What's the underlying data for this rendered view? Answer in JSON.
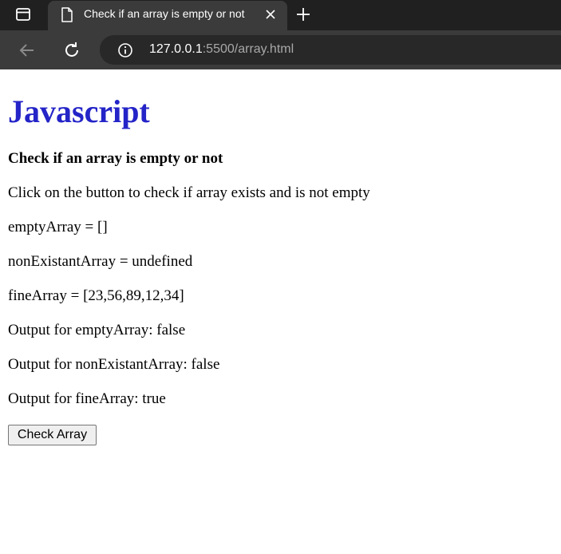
{
  "browser": {
    "tab": {
      "title": "Check if an array is empty or not"
    },
    "address": {
      "host": "127.0.0.1",
      "rest": ":5500/array.html"
    }
  },
  "page": {
    "heading": "Javascript",
    "subheading": "Check if an array is empty or not",
    "instruction": "Click on the button to check if array exists and is not empty",
    "empty_array": "emptyArray = []",
    "non_existant_array": "nonExistantArray = undefined",
    "fine_array": "fineArray = [23,56,89,12,34]",
    "output_empty": "Output for emptyArray: false",
    "output_non_existant": "Output for nonExistantArray: false",
    "output_fine": "Output for fineArray: true",
    "button_label": "Check Array"
  },
  "colors": {
    "heading": "#2424c8",
    "tabbar_bg": "#202020",
    "toolbar_bg": "#3b3b3b",
    "url_box_bg": "#282828"
  },
  "icons": [
    "tab-actions-icon",
    "document-icon",
    "close-icon",
    "new-tab-icon",
    "back-arrow-icon",
    "reload-icon",
    "info-icon"
  ]
}
